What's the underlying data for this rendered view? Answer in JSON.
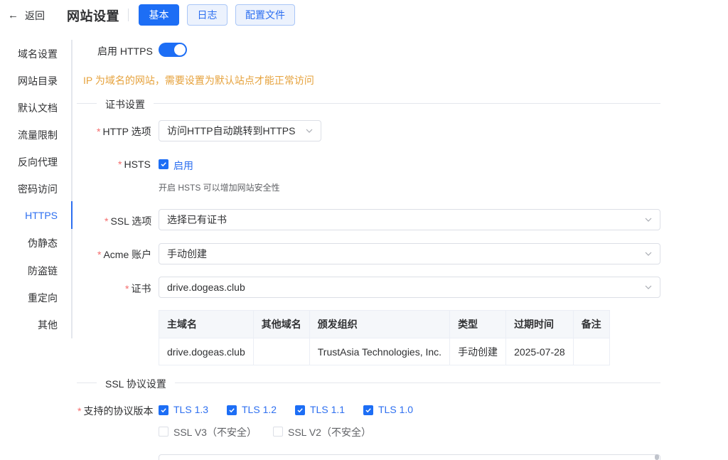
{
  "header": {
    "back_label": "返回",
    "back_icon": "arrow-left-icon",
    "title": "网站设置",
    "tabs": [
      {
        "label": "基本",
        "active": true
      },
      {
        "label": "日志",
        "active": false
      },
      {
        "label": "配置文件",
        "active": false
      }
    ]
  },
  "sidebar": {
    "items": [
      {
        "label": "域名设置"
      },
      {
        "label": "网站目录"
      },
      {
        "label": "默认文档"
      },
      {
        "label": "流量限制"
      },
      {
        "label": "反向代理"
      },
      {
        "label": "密码访问"
      },
      {
        "label": "HTTPS",
        "active": true
      },
      {
        "label": "伪静态"
      },
      {
        "label": "防盗链"
      },
      {
        "label": "重定向"
      },
      {
        "label": "其他"
      }
    ]
  },
  "https": {
    "enable_label": "启用 HTTPS",
    "enabled": true,
    "warning": "IP 为域名的网站，需要设置为默认站点才能正常访问"
  },
  "cert_section": {
    "title": "证书设置",
    "required_mark": "*",
    "http_option": {
      "label": "HTTP 选项",
      "value": "访问HTTP自动跳转到HTTPS"
    },
    "hsts": {
      "label": "HSTS",
      "checkbox_label": "启用",
      "checked": true,
      "hint": "开启 HSTS 可以增加网站安全性"
    },
    "ssl_option": {
      "label": "SSL 选项",
      "value": "选择已有证书"
    },
    "acme_account": {
      "label": "Acme 账户",
      "value": "手动创建"
    },
    "certificate": {
      "label": "证书",
      "value": "drive.dogeas.club"
    },
    "table": {
      "columns": [
        "主域名",
        "其他域名",
        "颁发组织",
        "类型",
        "过期时间",
        "备注"
      ],
      "rows": [
        [
          "drive.dogeas.club",
          "",
          "TrustAsia Technologies, Inc.",
          "手动创建",
          "2025-07-28",
          ""
        ]
      ]
    }
  },
  "ssl_protocol_section": {
    "title": "SSL 协议设置",
    "protocols_label": "支持的协议版本",
    "protocols": [
      {
        "label": "TLS 1.3",
        "checked": true
      },
      {
        "label": "TLS 1.2",
        "checked": true
      },
      {
        "label": "TLS 1.1",
        "checked": true
      },
      {
        "label": "TLS 1.0",
        "checked": true
      },
      {
        "label": "SSL V3（不安全）",
        "checked": false
      },
      {
        "label": "SSL V2（不安全）",
        "checked": false
      }
    ]
  },
  "colors": {
    "primary": "#1d6ef5",
    "warning": "#e6a23c",
    "required": "#f56c6c"
  }
}
